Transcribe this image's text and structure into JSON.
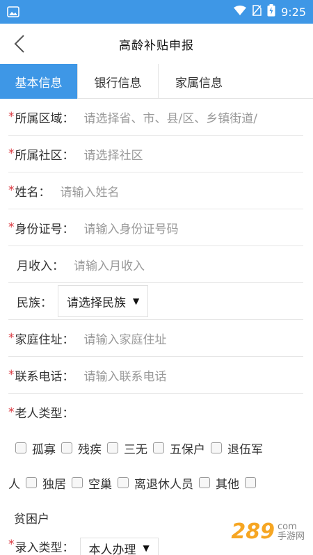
{
  "status": {
    "time": "9:25"
  },
  "header": {
    "title": "高龄补贴申报"
  },
  "tabs": [
    {
      "label": "基本信息"
    },
    {
      "label": "银行信息"
    },
    {
      "label": "家属信息"
    }
  ],
  "form": {
    "region": {
      "label": "所属区域：",
      "placeholder": "请选择省、市、县/区、乡镇街道/"
    },
    "community": {
      "label": "所属社区：",
      "placeholder": "请选择社区"
    },
    "name": {
      "label": "姓名：",
      "placeholder": "请输入姓名"
    },
    "idcard": {
      "label": "身份证号：",
      "placeholder": "请输入身份证号码"
    },
    "income": {
      "label": "月收入：",
      "placeholder": "请输入月收入"
    },
    "ethnicity": {
      "label": "民族：",
      "value": "请选择民族"
    },
    "address": {
      "label": "家庭住址：",
      "placeholder": "请输入家庭住址"
    },
    "phone": {
      "label": "联系电话：",
      "placeholder": "请输入联系电话"
    },
    "elder_type": {
      "label": "老人类型：",
      "options": [
        "孤寡",
        "残疾",
        "三无",
        "五保户",
        "退伍军人",
        "独居",
        "空巢",
        "离退休人员",
        "其他",
        "贫困户"
      ]
    },
    "entry_type": {
      "label": "录入类型：",
      "value": "本人办理"
    }
  },
  "watermark": {
    "brand": "289",
    "sub": "手游网",
    "sub2": "com"
  },
  "colors": {
    "primary": "#3e97e6",
    "required": "#d9363e"
  }
}
